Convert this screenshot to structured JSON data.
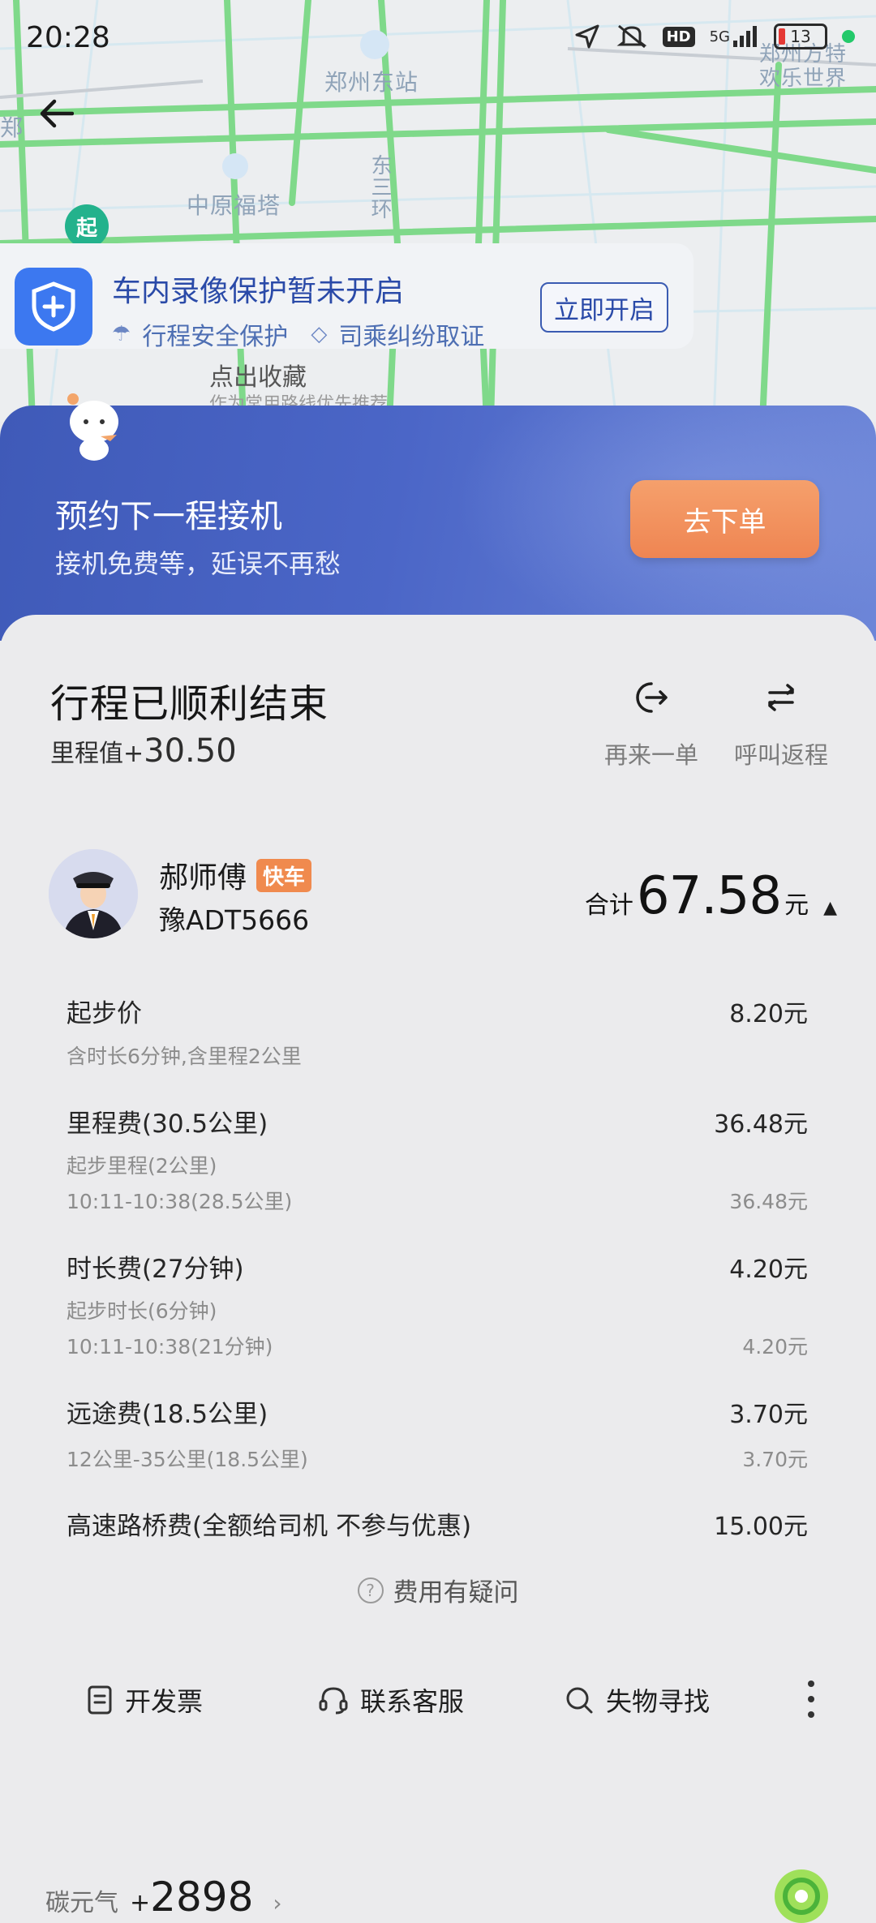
{
  "status_bar": {
    "time": "20:28",
    "network": "5G",
    "hd": "HD",
    "battery": "13"
  },
  "map": {
    "labels": [
      "郑州东站",
      "中原福塔",
      "东三环",
      "郑州方特欢乐世界",
      "郑"
    ],
    "start_marker": "起"
  },
  "record_card": {
    "title": "车内录像保护暂未开启",
    "tag1": "行程安全保护",
    "tag2": "司乘纠纷取证",
    "button": "立即开启",
    "peek_title": "点出收藏",
    "peek_sub": "作为常用路线优先推荐"
  },
  "banner": {
    "title": "预约下一程接机",
    "subtitle": "接机免费等，延误不再愁",
    "button": "去下单"
  },
  "trip": {
    "title": "行程已顺利结束",
    "mileage_label": "里程值+",
    "mileage_value": "30.50",
    "action_reorder": "再来一单",
    "action_return": "呼叫返程"
  },
  "driver": {
    "name": "郝师傅",
    "badge": "快车",
    "plate": "豫ADT5666"
  },
  "total": {
    "prefix": "合计",
    "amount": "67.58",
    "unit": "元"
  },
  "fees": {
    "base": {
      "name": "起步价",
      "value": "8.20元",
      "note": "含时长6分钟,含里程2公里"
    },
    "distance": {
      "name": "里程费(30.5公里)",
      "value": "36.48元",
      "sub1": "起步里程(2公里)",
      "sub2": "10:11-10:38(28.5公里)",
      "sub2_value": "36.48元"
    },
    "duration": {
      "name": "时长费(27分钟)",
      "value": "4.20元",
      "sub1": "起步时长(6分钟)",
      "sub2": "10:11-10:38(21分钟)",
      "sub2_value": "4.20元"
    },
    "long": {
      "name": "远途费(18.5公里)",
      "value": "3.70元",
      "sub1": "12公里-35公里(18.5公里)",
      "sub1_value": "3.70元"
    },
    "toll": {
      "name": "高速路桥费(全额给司机 不参与优惠)",
      "value": "15.00元"
    }
  },
  "question": "费用有疑问",
  "bottom_actions": {
    "invoice": "开发票",
    "service": "联系客服",
    "lost": "失物寻找"
  },
  "carbon": {
    "label": "碳元气",
    "plus": "+",
    "value": "2898"
  },
  "colors": {
    "accent": "#3c78f0",
    "banner": "#4b66c7",
    "order_btn": "#ef8552",
    "badge": "#f08a4e"
  }
}
